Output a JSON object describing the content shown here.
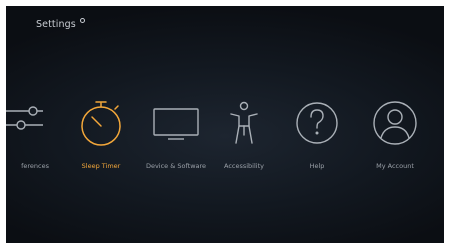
{
  "header": {
    "title": "Settings"
  },
  "settings": {
    "items": [
      {
        "label": "ferences",
        "icon": "sliders-icon"
      },
      {
        "label": "Sleep Timer",
        "icon": "stopwatch-icon",
        "selected": true
      },
      {
        "label": "Device & Software",
        "icon": "tv-icon"
      },
      {
        "label": "Accessibility",
        "icon": "accessibility-person-icon"
      },
      {
        "label": "Help",
        "icon": "help-question-icon"
      },
      {
        "label": "My Account",
        "icon": "user-account-icon"
      }
    ]
  },
  "colors": {
    "accent": "#f3a73a",
    "icon": "#aab0b7",
    "label": "#9aa0a8"
  }
}
